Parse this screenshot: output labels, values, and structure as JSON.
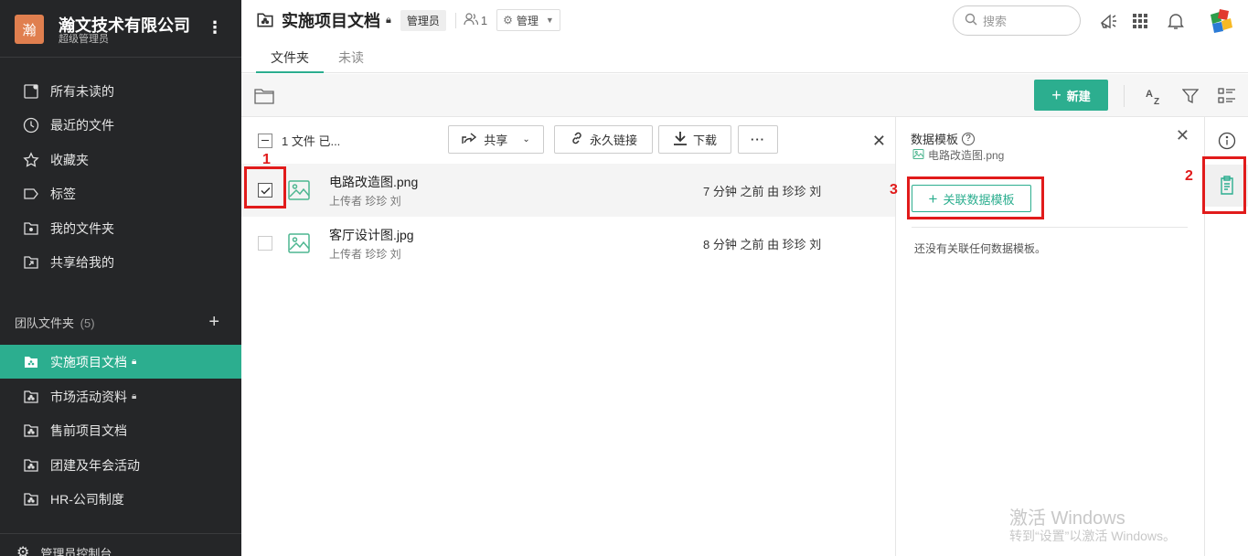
{
  "org": {
    "logo_text": "瀚",
    "name": "瀚文技术有限公司",
    "role": "超级管理员"
  },
  "sidebar": {
    "items": [
      {
        "label": "所有未读的",
        "icon": "unread-icon"
      },
      {
        "label": "最近的文件",
        "icon": "clock-icon"
      },
      {
        "label": "收藏夹",
        "icon": "star-icon"
      },
      {
        "label": "标签",
        "icon": "tag-icon"
      },
      {
        "label": "我的文件夹",
        "icon": "my-folder-icon"
      },
      {
        "label": "共享给我的",
        "icon": "shared-folder-icon"
      }
    ],
    "team_header": "团队文件夹",
    "team_count": "(5)",
    "team_folders": [
      {
        "label": "实施项目文档",
        "locked": true,
        "active": true
      },
      {
        "label": "市场活动资料",
        "locked": true,
        "active": false
      },
      {
        "label": "售前项目文档",
        "locked": false,
        "active": false
      },
      {
        "label": "团建及年会活动",
        "locked": false,
        "active": false
      },
      {
        "label": "HR-公司制度",
        "locked": false,
        "active": false
      }
    ],
    "admin_console": "管理员控制台"
  },
  "header": {
    "title": "实施项目文档",
    "role_badge": "管理员",
    "member_count": "1",
    "manage_label": "管理",
    "search_placeholder": "搜索",
    "tabs": [
      "文件夹",
      "未读"
    ]
  },
  "toolbar": {
    "new_label": "新建"
  },
  "actionbar": {
    "selected_text": "1 文件 已...",
    "share_label": "共享",
    "permalink_label": "永久链接",
    "download_label": "下载",
    "more_label": "···"
  },
  "files": [
    {
      "name": "电路改造图.png",
      "uploader": "上传者 珍珍 刘",
      "time": "7 分钟 之前 由 珍珍 刘",
      "selected": true
    },
    {
      "name": "客厅设计图.jpg",
      "uploader": "上传者 珍珍 刘",
      "time": "8 分钟 之前 由 珍珍 刘",
      "selected": false
    }
  ],
  "panel": {
    "title": "数据模板",
    "help_mark": "?",
    "file_name": "电路改造图.png",
    "associate_label": "关联数据模板",
    "empty_text": "还没有关联任何数据模板。"
  },
  "annotations": [
    "1",
    "2",
    "3"
  ],
  "watermark": {
    "line1": "激活 Windows",
    "line2": "转到“设置”以激活 Windows。"
  },
  "colors": {
    "accent": "#2cae8f",
    "sidebar_bg": "#252628",
    "annotation": "#e11b1b"
  }
}
